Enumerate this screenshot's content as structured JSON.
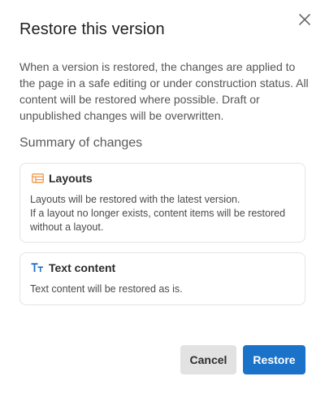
{
  "dialog": {
    "title": "Restore this version",
    "description": "When a version is restored, the changes are applied to the page in a safe editing or under construction status. All content will be restored where possible. Draft or unpublished changes will be overwritten.",
    "summary_heading": "Summary of changes",
    "close_icon": "close-icon"
  },
  "changes": [
    {
      "icon": "layout-icon",
      "title": "Layouts",
      "lines": [
        "Layouts will be restored with the latest version.",
        "If a layout no longer exists, content items will be restored without a layout."
      ]
    },
    {
      "icon": "text-size-icon",
      "title": "Text content",
      "lines": [
        "Text content will be restored as is."
      ]
    }
  ],
  "buttons": {
    "cancel_label": "Cancel",
    "restore_label": "Restore"
  },
  "colors": {
    "primary": "#1a73c8",
    "layout_icon": "#f2a05a",
    "text_icon": "#1a73c8",
    "secondary_button": "#e2e2e2"
  }
}
